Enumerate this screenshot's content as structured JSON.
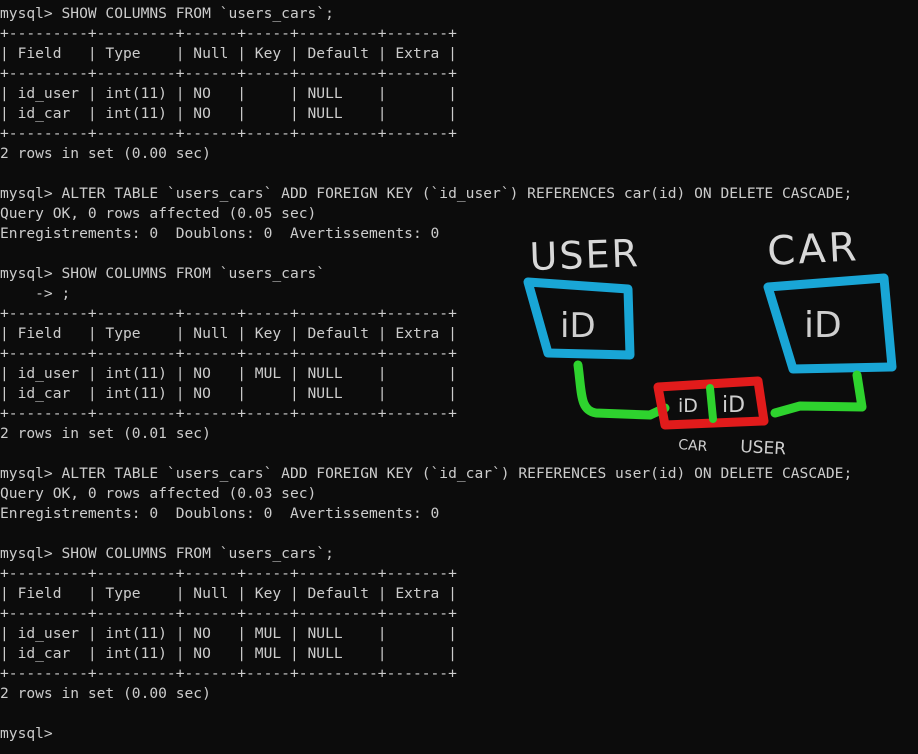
{
  "terminal": {
    "lines": [
      "mysql> SHOW COLUMNS FROM `users_cars`;",
      "+---------+---------+------+-----+---------+-------+",
      "| Field   | Type    | Null | Key | Default | Extra |",
      "+---------+---------+------+-----+---------+-------+",
      "| id_user | int(11) | NO   |     | NULL    |       |",
      "| id_car  | int(11) | NO   |     | NULL    |       |",
      "+---------+---------+------+-----+---------+-------+",
      "2 rows in set (0.00 sec)",
      "",
      "mysql> ALTER TABLE `users_cars` ADD FOREIGN KEY (`id_user`) REFERENCES car(id) ON DELETE CASCADE;",
      "Query OK, 0 rows affected (0.05 sec)",
      "Enregistrements: 0  Doublons: 0  Avertissements: 0",
      "",
      "mysql> SHOW COLUMNS FROM `users_cars`",
      "    -> ;",
      "+---------+---------+------+-----+---------+-------+",
      "| Field   | Type    | Null | Key | Default | Extra |",
      "+---------+---------+------+-----+---------+-------+",
      "| id_user | int(11) | NO   | MUL | NULL    |       |",
      "| id_car  | int(11) | NO   |     | NULL    |       |",
      "+---------+---------+------+-----+---------+-------+",
      "2 rows in set (0.01 sec)",
      "",
      "mysql> ALTER TABLE `users_cars` ADD FOREIGN KEY (`id_car`) REFERENCES user(id) ON DELETE CASCADE;",
      "Query OK, 0 rows affected (0.03 sec)",
      "Enregistrements: 0  Doublons: 0  Avertissements: 0",
      "",
      "mysql> SHOW COLUMNS FROM `users_cars`;",
      "+---------+---------+------+-----+---------+-------+",
      "| Field   | Type    | Null | Key | Default | Extra |",
      "+---------+---------+------+-----+---------+-------+",
      "| id_user | int(11) | NO   | MUL | NULL    |       |",
      "| id_car  | int(11) | NO   | MUL | NULL    |       |",
      "+---------+---------+------+-----+---------+-------+",
      "2 rows in set (0.00 sec)",
      "",
      "mysql>"
    ]
  },
  "sketch": {
    "user_label": "USER",
    "car_label": "CAR",
    "user_box_label": "iD",
    "car_box_label": "iD",
    "junction_left_label": "iD",
    "junction_right_label": "iD",
    "junction_left_caption": "CAR",
    "junction_right_caption": "USER"
  },
  "colors": {
    "background": "#0c0c0c",
    "text": "#cccccc",
    "sketch_blue": "#19a6d6",
    "sketch_green": "#2ed32e",
    "sketch_red": "#e11b1b",
    "sketch_white": "#d8d8d8"
  }
}
